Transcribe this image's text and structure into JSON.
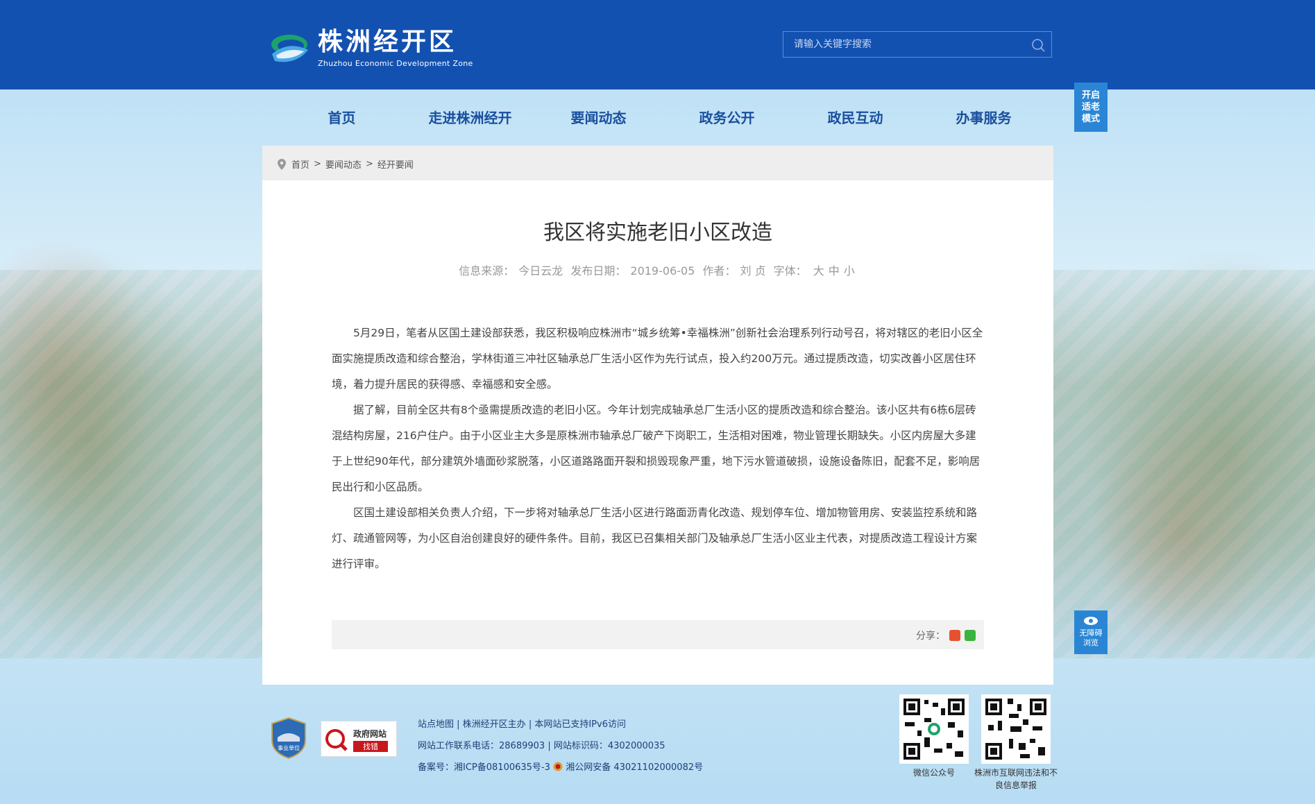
{
  "site": {
    "name_cn": "株洲经开区",
    "name_en": "Zhuzhou Economic Development Zone",
    "search_placeholder": "请输入关键字搜索"
  },
  "nav": [
    "首页",
    "走进株洲经开",
    "要闻动态",
    "政务公开",
    "政民互动",
    "办事服务"
  ],
  "side": {
    "elder_mode": [
      "开启",
      "适老",
      "模式"
    ],
    "accessibility": [
      "无障碍",
      "浏览"
    ]
  },
  "breadcrumb": [
    "首页",
    "要闻动态",
    "经开要闻"
  ],
  "article": {
    "title": "我区将实施老旧小区改造",
    "source_label": "信息来源：",
    "source": "今日云龙",
    "date_label": "发布日期：",
    "date": "2019-06-05",
    "author_label": "作者：",
    "author": "刘 贞",
    "font_label": "字体：",
    "font_sizes": [
      "大",
      "中",
      "小"
    ],
    "paragraphs": [
      "5月29日，笔者从区国土建设部获悉，我区积极响应株洲市“城乡统筹•幸福株洲”创新社会治理系列行动号召，将对辖区的老旧小区全面实施提质改造和综合整治，学林街道三冲社区轴承总厂生活小区作为先行试点，投入约200万元。通过提质改造，切实改善小区居住环境，着力提升居民的获得感、幸福感和安全感。",
      "据了解，目前全区共有8个亟需提质改造的老旧小区。今年计划完成轴承总厂生活小区的提质改造和综合整治。该小区共有6栋6层砖混结构房屋，216户住户。由于小区业主大多是原株洲市轴承总厂破产下岗职工，生活相对困难，物业管理长期缺失。小区内房屋大多建于上世纪90年代，部分建筑外墙面砂浆脱落，小区道路路面开裂和损毁现象严重，地下污水管道破损，设施设备陈旧，配套不足，影响居民出行和小区品质。",
      "区国土建设部相关负责人介绍，下一步将对轴承总厂生活小区进行路面沥青化改造、规划停车位、增加物管用房、安装监控系统和路灯、疏通管网等，为小区自治创建良好的硬件条件。目前，我区已召集相关部门及轴承总厂生活小区业主代表，对提质改造工程设计方案进行评审。"
    ],
    "share_label": "分享："
  },
  "footer": {
    "badge_text": "事业单位",
    "gov_site_top": "政府网站",
    "gov_site_bottom": "找错",
    "links": [
      "站点地图",
      "株洲经开区主办",
      "本网站已支持IPv6访问"
    ],
    "phone_label": "网站工作联系电话：",
    "phone": "28689903",
    "site_id_label": "网站标识码：",
    "site_id": "4302000035",
    "icp_label": "备案号：",
    "icp": "湘ICP备08100635号-3",
    "police": "湘公网安备 43021102000082号",
    "qr1_caption": "微信公众号",
    "qr2_caption": "株洲市互联网违法和不良信息举报"
  },
  "colors": {
    "header_bg": "#1351b1",
    "nav_text": "#1a4f9e",
    "side_btn": "#2a86d4"
  }
}
